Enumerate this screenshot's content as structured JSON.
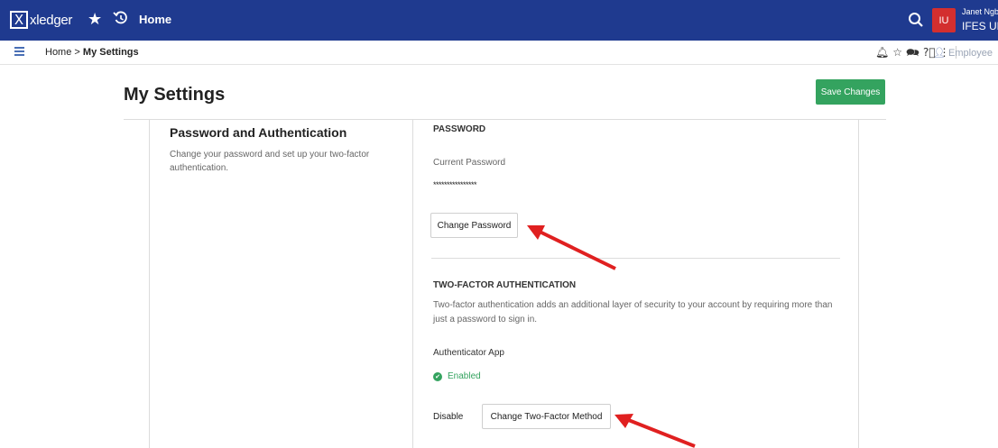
{
  "topbar": {
    "logo_mark": "X",
    "logo_text": "xledger",
    "home_label": "Home",
    "avatar_initials": "IU",
    "user_name": "Janet Ngbe",
    "user_org": "IFES UK"
  },
  "subbar": {
    "breadcrumb_home": "Home",
    "breadcrumb_sep": ">",
    "breadcrumb_current": "My Settings",
    "role_label": "Employee"
  },
  "page": {
    "title": "My Settings",
    "save_label": "Save Changes"
  },
  "section": {
    "heading": "Password and Authentication",
    "description": "Change your password and set up your two-factor authentication."
  },
  "password": {
    "heading": "PASSWORD",
    "current_label": "Current Password",
    "current_value": "****************",
    "change_button": "Change Password"
  },
  "two_factor": {
    "heading": "TWO-FACTOR AUTHENTICATION",
    "description": "Two-factor authentication adds an additional layer of security to your account by requiring more than just a password to sign in.",
    "app_label": "Authenticator App",
    "status": "Enabled",
    "disable_label": "Disable",
    "change_button": "Change Two-Factor Method"
  },
  "colors": {
    "topbar": "#1f3a8f",
    "accent_green": "#34a35f",
    "avatar": "#d32f2f",
    "annotation_arrow": "#e02020"
  },
  "icons": [
    "star-icon",
    "history-icon",
    "search-icon",
    "hamburger-icon",
    "notification-icon",
    "favorite-icon",
    "chat-icon",
    "help-icon",
    "more-icon",
    "person-icon",
    "check-circle-icon"
  ]
}
